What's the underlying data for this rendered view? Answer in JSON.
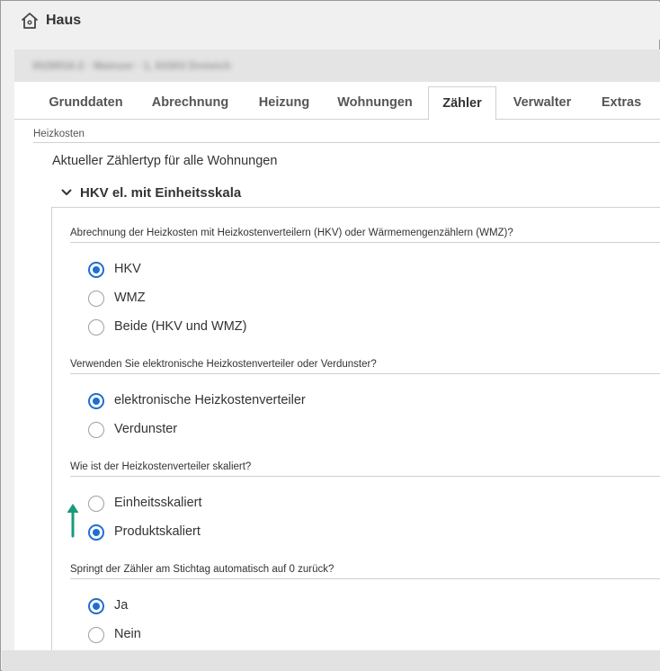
{
  "header": {
    "title": "Haus",
    "icon": "house-icon"
  },
  "address": {
    "text": "0028916-2 · Mainzer · 1, 63303 Dreieich"
  },
  "tabs": [
    {
      "label": "Grunddaten",
      "active": false
    },
    {
      "label": "Abrechnung",
      "active": false
    },
    {
      "label": "Heizung",
      "active": false
    },
    {
      "label": "Wohnungen",
      "active": false
    },
    {
      "label": "Zähler",
      "active": true
    },
    {
      "label": "Verwalter",
      "active": false
    },
    {
      "label": "Extras",
      "active": false
    }
  ],
  "section": {
    "label": "Heizkosten",
    "meter_type_label": "Aktueller Zählertyp für alle Wohnungen",
    "accordion_title": "HKV el. mit Einheitsskala"
  },
  "questions": [
    {
      "text": "Abrechnung der Heizkosten mit Heizkostenverteilern (HKV) oder Wärmemengenzählern (WMZ)?",
      "options": [
        {
          "label": "HKV",
          "checked": true
        },
        {
          "label": "WMZ",
          "checked": false
        },
        {
          "label": "Beide (HKV und WMZ)",
          "checked": false
        }
      ]
    },
    {
      "text": "Verwenden Sie elektronische Heizkostenverteiler oder Verdunster?",
      "options": [
        {
          "label": "elektronische Heizkostenverteiler",
          "checked": true
        },
        {
          "label": "Verdunster",
          "checked": false
        }
      ]
    },
    {
      "text": "Wie ist der Heizkostenverteiler skaliert?",
      "options": [
        {
          "label": "Einheitsskaliert",
          "checked": false
        },
        {
          "label": "Produktskaliert",
          "checked": true
        }
      ]
    },
    {
      "text": "Springt der Zähler am Stichtag automatisch auf 0 zurück?",
      "options": [
        {
          "label": "Ja",
          "checked": true
        },
        {
          "label": "Nein",
          "checked": false
        }
      ]
    }
  ],
  "colors": {
    "accent": "#1e6fd1",
    "arrow": "#1a9a7c"
  }
}
